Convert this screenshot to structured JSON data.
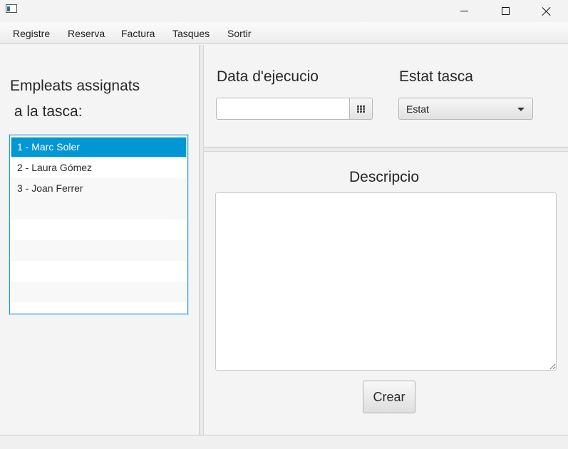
{
  "window": {
    "controls": {
      "minimize_icon": "minimize-icon",
      "maximize_icon": "maximize-icon",
      "close_icon": "close-icon"
    }
  },
  "menu": {
    "items": [
      "Registre",
      "Reserva",
      "Factura",
      "Tasques",
      "Sortir"
    ]
  },
  "left": {
    "title_line1": "Empleats assignats",
    "title_line2": " a la tasca:",
    "employees": [
      {
        "label": "1 - Marc Soler",
        "selected": true
      },
      {
        "label": "2 - Laura Gómez",
        "selected": false
      },
      {
        "label": "3 - Joan Ferrer",
        "selected": false
      }
    ],
    "empty_rows": 5
  },
  "form": {
    "date_label": "Data d'ejecucio",
    "date_value": "",
    "state_label": "Estat tasca",
    "state_value": "Estat",
    "description_label": "Descripcio",
    "description_value": "",
    "create_label": "Crear"
  },
  "colors": {
    "selection": "#0097d3",
    "list_border": "#2a9bd1"
  }
}
